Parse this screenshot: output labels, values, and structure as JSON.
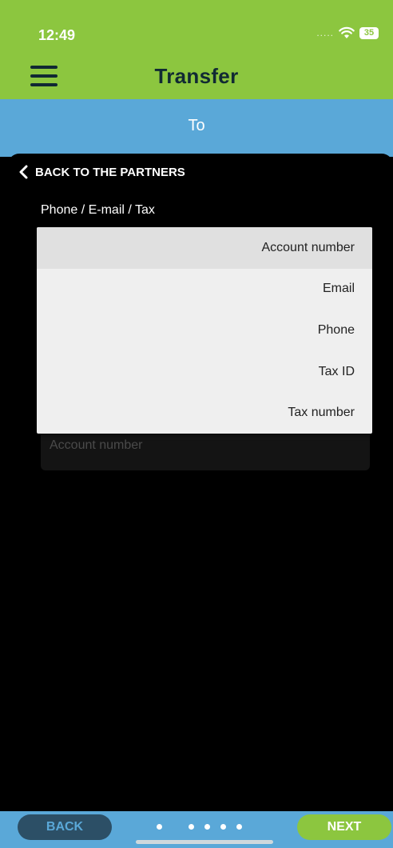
{
  "status_bar": {
    "time": "12:49",
    "signal": ".....",
    "battery": "35"
  },
  "header": {
    "title": "Transfer"
  },
  "subheader": {
    "label": "To"
  },
  "content": {
    "back_link": "BACK TO THE PARTNERS",
    "field_label": "Phone / E-mail / Tax",
    "input_placeholder": "Account number"
  },
  "dropdown": {
    "selected": "Account number",
    "options": [
      "Account number",
      "Email",
      "Phone",
      "Tax ID",
      "Tax number"
    ]
  },
  "footer": {
    "back_label": "BACK",
    "next_label": "NEXT",
    "pager": {
      "total": 6,
      "active_index": 1
    }
  },
  "colors": {
    "green": "#8cc63f",
    "blue": "#5aa8d8",
    "dark_navy": "#2c4f66",
    "black": "#000000"
  }
}
